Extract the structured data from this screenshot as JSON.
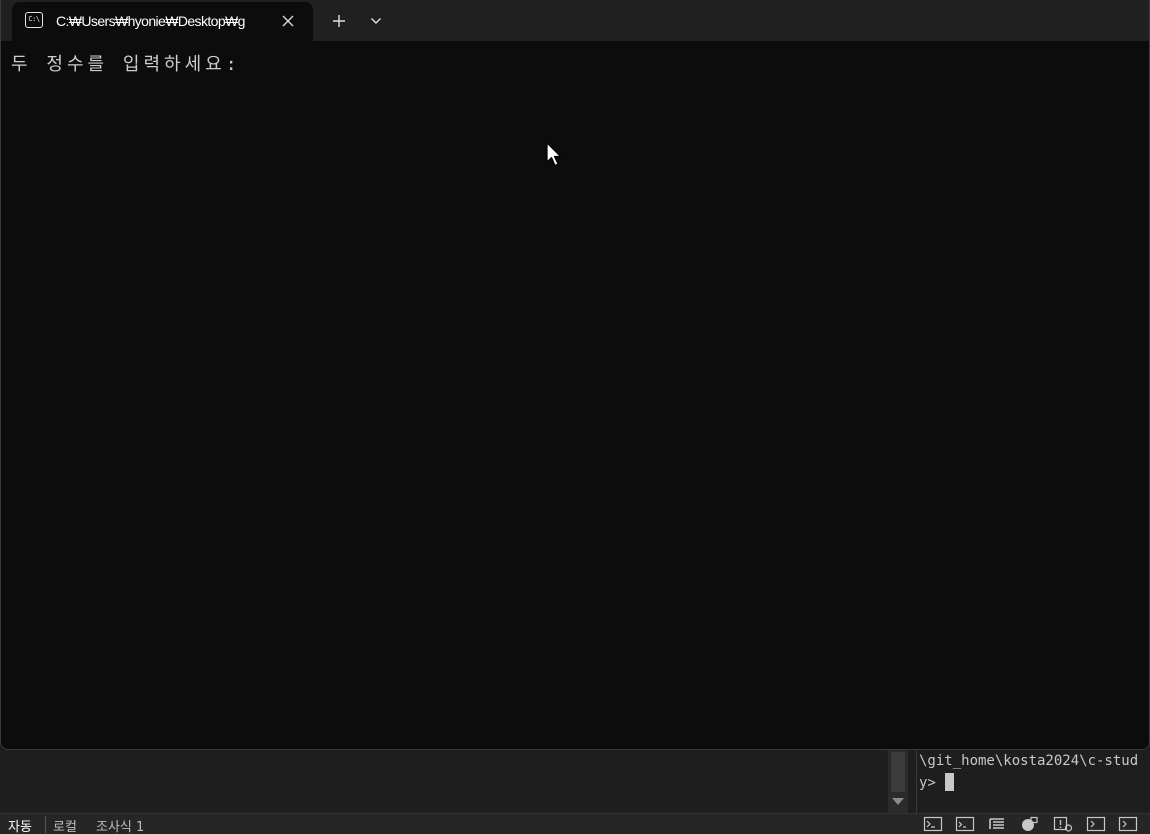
{
  "tab": {
    "title": "C:₩Users₩hyonie₩Desktop₩g",
    "icon": "console-icon",
    "icon_glyph": "C:\\"
  },
  "terminal": {
    "prompt_text": "두 정수를 입력하세요:"
  },
  "ide_terminal": {
    "line1": "\\git_home\\kosta2024\\c-stud",
    "line2": "y>"
  },
  "statusbar": {
    "tabs": [
      "자동",
      "로컬",
      "조사식 1"
    ]
  },
  "colors": {
    "terminal_bg": "#0c0c0c",
    "tabbar_bg": "#202020",
    "text": "#cccccc"
  }
}
